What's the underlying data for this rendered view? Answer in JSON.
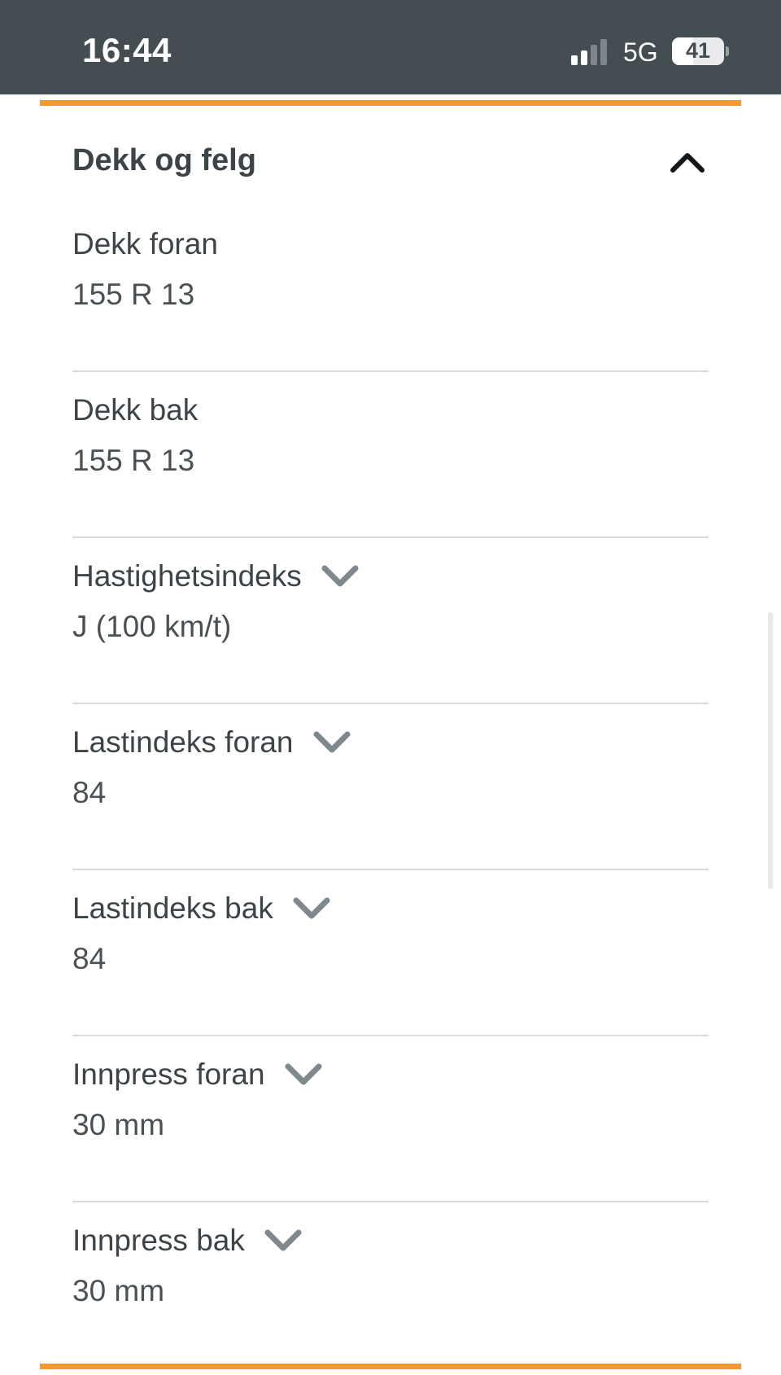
{
  "status_bar": {
    "time": "16:44",
    "network": "5G",
    "battery_level": "41",
    "signal_bars_active": 2,
    "signal_bars_total": 4
  },
  "section": {
    "title": "Dekk og felg",
    "expanded": true
  },
  "rows": [
    {
      "label": "Dekk foran",
      "value": "155 R 13",
      "has_info_toggle": false
    },
    {
      "label": "Dekk bak",
      "value": "155 R 13",
      "has_info_toggle": false
    },
    {
      "label": "Hastighetsindeks",
      "value": "J (100 km/t)",
      "has_info_toggle": true
    },
    {
      "label": "Lastindeks foran",
      "value": "84",
      "has_info_toggle": true
    },
    {
      "label": "Lastindeks bak",
      "value": "84",
      "has_info_toggle": true
    },
    {
      "label": "Innpress foran",
      "value": "30 mm",
      "has_info_toggle": true
    },
    {
      "label": "Innpress bak",
      "value": "30 mm",
      "has_info_toggle": true
    }
  ],
  "colors": {
    "status_bar_bg": "#434d52",
    "accent_orange": "#f29a2e",
    "text_primary": "#3d4448",
    "chevron_gray": "#7f898d",
    "divider": "#d8dadb"
  },
  "icons": {
    "section_toggle": "chevron-up-icon",
    "row_toggle": "chevron-down-icon",
    "signal": "signal-icon",
    "battery": "battery-icon"
  }
}
